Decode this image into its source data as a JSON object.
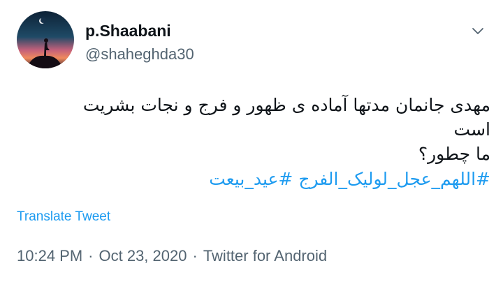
{
  "user": {
    "display_name": "p.Shaabani",
    "handle": "@shaheghda30"
  },
  "tweet": {
    "lines": [
      "مهدی جانمان مدتها آماده ی ظهور و فرج و نجات بشریت",
      "است",
      "ما چطور؟"
    ],
    "hashtags": [
      "#اللهم_عجل_لولیک_الفرج",
      "#عید_بیعت"
    ]
  },
  "translate_label": "Translate Tweet",
  "meta": {
    "time": "10:24 PM",
    "separator": "·",
    "date": "Oct 23, 2020",
    "source": "Twitter for Android"
  },
  "colors": {
    "link": "#1d9bf0",
    "secondary_text": "#536471",
    "primary_text": "#0f1419"
  },
  "icons": {
    "more": "chevron-down-icon",
    "avatar": "avatar-silhouette-sunset"
  }
}
